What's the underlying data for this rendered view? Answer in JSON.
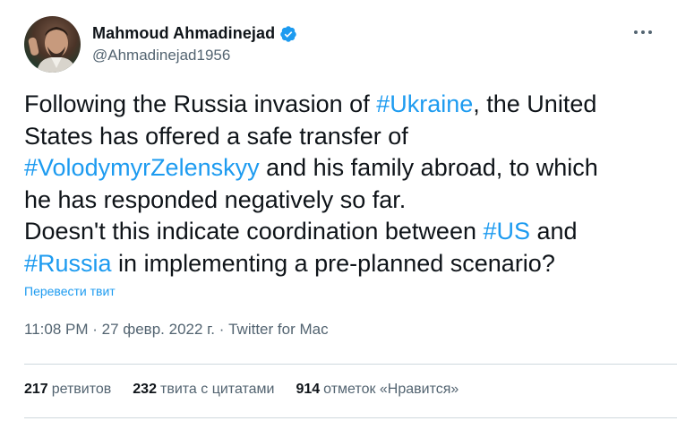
{
  "author": {
    "display_name": "Mahmoud Ahmadinejad",
    "handle": "@Ahmadinejad1956",
    "verified": true,
    "avatar_icon": "avatar-photo",
    "verified_icon": "verified-badge-icon",
    "verified_color": "#1d9bf0"
  },
  "tweet": {
    "segments": [
      {
        "text": "Following the Russia invasion of ",
        "hashtag": false
      },
      {
        "text": "#Ukraine",
        "hashtag": true
      },
      {
        "text": ", the United\nStates has offered a safe transfer of\n",
        "hashtag": false
      },
      {
        "text": "#VolodymyrZelenskyy",
        "hashtag": true
      },
      {
        "text": " and his family abroad, to which\nhe has responded negatively so far.\nDoesn't this indicate coordination between ",
        "hashtag": false
      },
      {
        "text": "#US",
        "hashtag": true
      },
      {
        "text": " and\n",
        "hashtag": false
      },
      {
        "text": "#Russia",
        "hashtag": true
      },
      {
        "text": " in implementing a pre-planned scenario?",
        "hashtag": false
      }
    ],
    "translate_label": "Перевести твит",
    "meta": "11:08 PM · 27 февр. 2022 г. · Twitter for Mac"
  },
  "stats": [
    {
      "count": "217",
      "label": "ретвитов"
    },
    {
      "count": "232",
      "label": "твита с цитатами"
    },
    {
      "count": "914",
      "label": "отметок «Нравится»"
    }
  ],
  "colors": {
    "link": "#1d9bf0",
    "text": "#0f1419",
    "secondary": "#536471",
    "divider": "#cfd9de"
  },
  "more_icon": "more-options-icon"
}
